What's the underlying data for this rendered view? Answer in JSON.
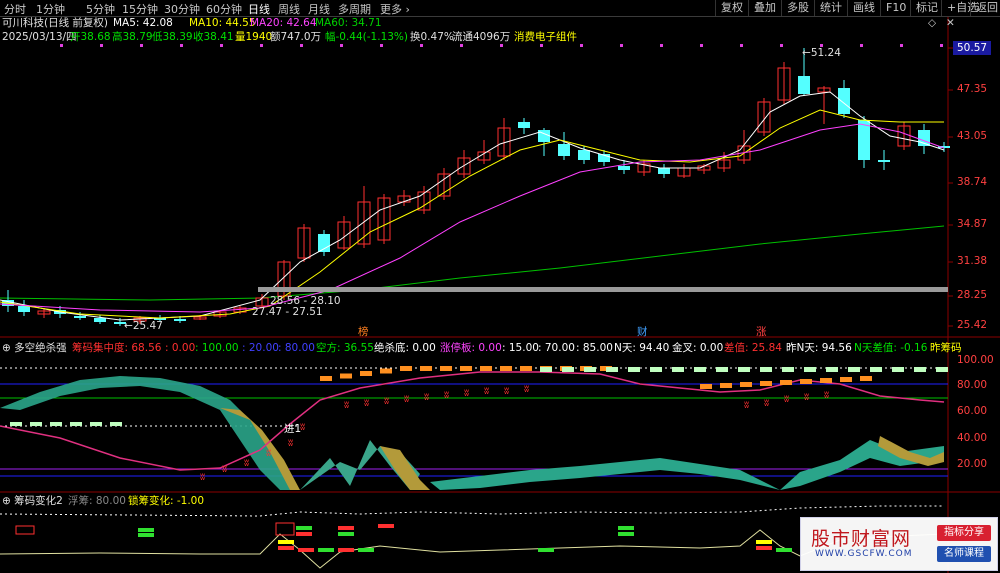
{
  "toolbar": {
    "periods": [
      "分时",
      "1分钟",
      "5分钟",
      "15分钟",
      "30分钟",
      "60分钟",
      "日线",
      "周线",
      "月线",
      "多周期",
      "更多 ›"
    ],
    "active_period": "日线",
    "right_buttons": [
      "复权",
      "叠加",
      "多股",
      "统计",
      "画线",
      "F10",
      "标记",
      "+自选",
      "返回"
    ]
  },
  "header": {
    "stock_title": "可川科技(日线 前复权)",
    "ma5": "MA5: 42.08",
    "ma10": "MA10: 44.55",
    "ma20": "MA20: 42.64",
    "ma60": "MA60: 34.71",
    "line2_date": "2025/03/13/四",
    "line2_open": "开38.68",
    "line2_high": "高38.79",
    "line2_low": "低38.39",
    "line2_close": "收38.41",
    "line2_vol": "量1940",
    "line2_amount": "额747.0万",
    "line2_change": "幅-0.44(-1.13%)",
    "line2_turnover": "换0.47%",
    "line2_float": "流通4096万",
    "line2_sector": "消费电子组件"
  },
  "price_axis": {
    "labels": [
      "50.57",
      "47.35",
      "43.05",
      "38.74",
      "34.87",
      "31.38",
      "28.25",
      "25.42"
    ],
    "current": "50.57"
  },
  "annotations": {
    "high": "51.24",
    "low": "25.47",
    "box1": "28.56 - 28.10",
    "box2": "27.47 - 27.51",
    "mark1": "榜",
    "mark2": "财",
    "mark3": "涨"
  },
  "indicator1": {
    "name": "多空绝杀强",
    "chip_conc": "筹码集中度: 68.56",
    "v1": ": 0.00",
    "v2": ": 100.00",
    "v3": ": 20.00",
    "v4": ": 80.00",
    "kongfang": "空方: 36.55",
    "juesha": "绝杀底: 0.00",
    "zhangting": "涨停板: 0.00",
    "v5": ": 15.00",
    "v6": ": 70.00",
    "v7": ": 85.00",
    "nday": "N天: 94.40",
    "jincha": "金叉: 0.00",
    "chazhi": "差值: 25.84",
    "zuonday": "昨N天: 94.56",
    "ndaycha": "N天差值: -0.16",
    "zuochou": "昨筹码",
    "axis": [
      "100.00",
      "80.00",
      "60.00",
      "40.00",
      "20.00"
    ],
    "jin": "进1"
  },
  "indicator2": {
    "name": "筹码变化2",
    "fuchou": "浮筹: 80.00",
    "suochou": "锁筹变化: -1.00"
  },
  "watermark": {
    "logo": "股市财富网",
    "url": "WWW.GSCFW.COM",
    "tag1": "指标分享",
    "tag2": "名师课程"
  },
  "colors": {
    "up": "#ff3030",
    "down": "#54ffff",
    "ma5": "#ffffff",
    "ma10": "#ffff00",
    "ma20": "#ff00ff",
    "ma60": "#00c000"
  }
}
